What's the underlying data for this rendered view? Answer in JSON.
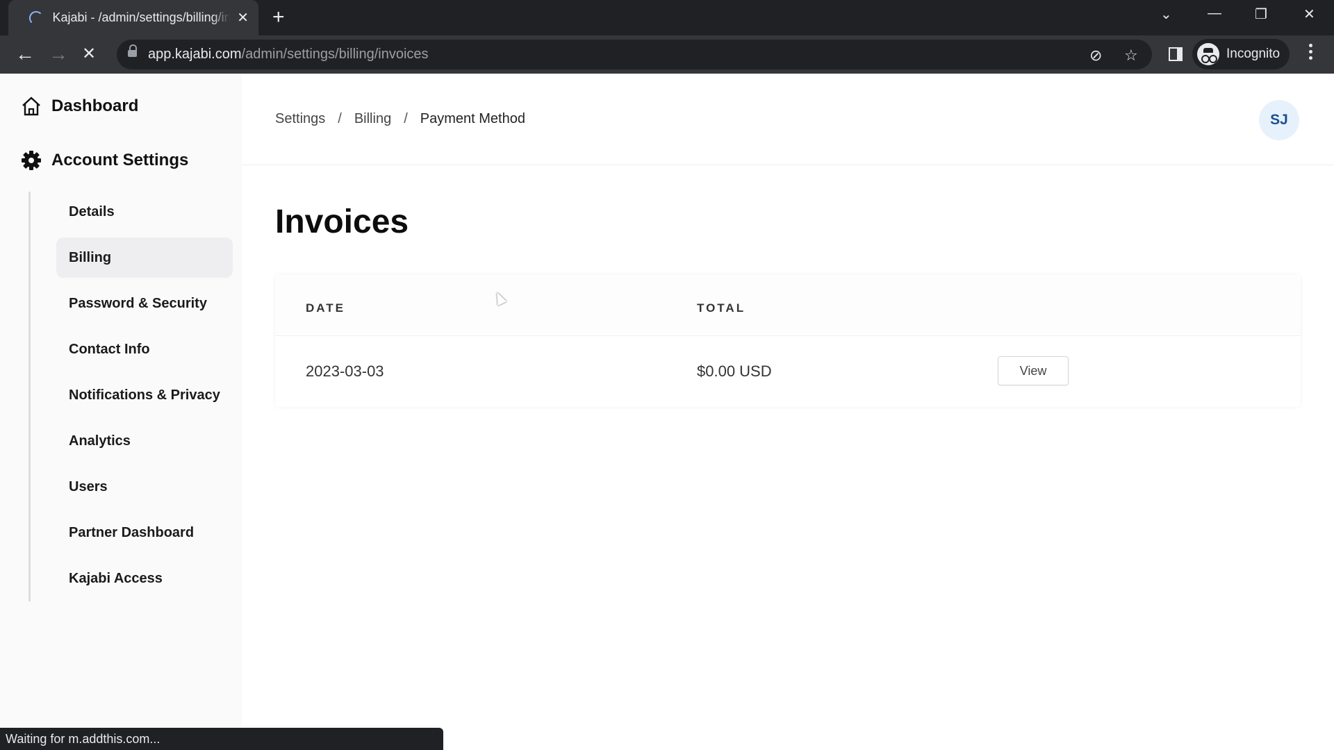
{
  "browser": {
    "tab_title": "Kajabi - /admin/settings/billing/invoices",
    "new_tab_label": "+",
    "url_host": "app.kajabi.com",
    "url_path": "/admin/settings/billing/invoices",
    "profile_label": "Incognito",
    "status_text": "Waiting for m.addthis.com...",
    "icons": {
      "back": "←",
      "forward": "→",
      "stop": "✕",
      "tab_close": "✕",
      "star": "☆",
      "eye_off": "⊘",
      "minimize": "—",
      "restore": "❐",
      "close": "✕",
      "tab_search": "⌄"
    }
  },
  "sidebar": {
    "dashboard_label": "Dashboard",
    "account_settings_label": "Account Settings",
    "items": [
      {
        "label": "Details",
        "active": false
      },
      {
        "label": "Billing",
        "active": true
      },
      {
        "label": "Password & Security",
        "active": false
      },
      {
        "label": "Contact Info",
        "active": false
      },
      {
        "label": "Notifications & Privacy",
        "active": false
      },
      {
        "label": "Analytics",
        "active": false
      },
      {
        "label": "Users",
        "active": false
      },
      {
        "label": "Partner Dashboard",
        "active": false
      },
      {
        "label": "Kajabi Access",
        "active": false
      }
    ]
  },
  "header": {
    "breadcrumb": [
      "Settings",
      "Billing",
      "Payment Method"
    ],
    "separator": "/",
    "avatar_initials": "SJ"
  },
  "main": {
    "title": "Invoices",
    "table": {
      "columns": [
        "DATE",
        "TOTAL"
      ],
      "rows": [
        {
          "date": "2023-03-03",
          "total": "$0.00 USD",
          "action_label": "View"
        }
      ]
    }
  }
}
